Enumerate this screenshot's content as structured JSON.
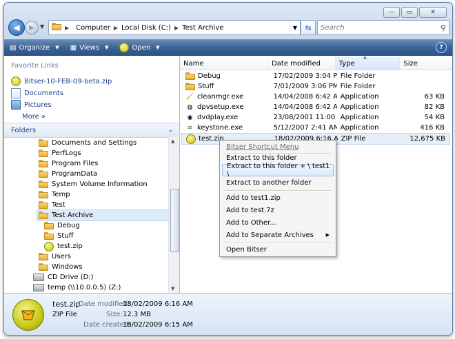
{
  "window": {
    "caption_buttons": {
      "minimize": "—",
      "maximize": "▭",
      "close": "✕"
    }
  },
  "address": {
    "segments": [
      "Computer",
      "Local Disk (C:)",
      "Test Archive"
    ],
    "search_placeholder": "Search"
  },
  "toolbar": {
    "organize": "Organize",
    "views": "Views",
    "open": "Open",
    "help": "?"
  },
  "favorites": {
    "title": "Favorite Links",
    "items": [
      "Bitser-10-FEB-09-beta.zip",
      "Documents",
      "Pictures"
    ],
    "more": "More »"
  },
  "folders": {
    "title": "Folders",
    "tree": [
      "Documents and Settings",
      "PerfLogs",
      "Program Files",
      "ProgramData",
      "System Volume Information",
      "Temp",
      "Test",
      "Test Archive",
      "Debug",
      "Stuff",
      "test.zip",
      "Users",
      "Windows",
      "CD Drive (D:)",
      "temp (\\\\10.0.0.5) (Z:)"
    ]
  },
  "columns": {
    "name": "Name",
    "date": "Date modified",
    "type": "Type",
    "size": "Size"
  },
  "files": [
    {
      "name": "Debug",
      "date": "17/02/2009 3:04 PM",
      "type": "File Folder",
      "size": ""
    },
    {
      "name": "Stuff",
      "date": "7/01/2009 3:06 PM",
      "type": "File Folder",
      "size": ""
    },
    {
      "name": "cleanmgr.exe",
      "date": "14/04/2008 6:42 AM",
      "type": "Application",
      "size": "63 KB"
    },
    {
      "name": "dpvsetup.exe",
      "date": "14/04/2008 6:42 AM",
      "type": "Application",
      "size": "82 KB"
    },
    {
      "name": "dvdplay.exe",
      "date": "23/08/2001 11:00 ...",
      "type": "Application",
      "size": "54 KB"
    },
    {
      "name": "keystone.exe",
      "date": "5/12/2007 2:41 AM",
      "type": "Application",
      "size": "416 KB"
    },
    {
      "name": "test.zip",
      "date": "18/02/2009 6:16 AM",
      "type": "ZIP File",
      "size": "12,675 KB"
    }
  ],
  "context_menu": {
    "title": "Bitser Shortcut Menu",
    "items": [
      "Extract to this folder",
      "Extract to this folder + \\ test1 \\",
      "Extract to another folder",
      "Add to test1.zip",
      "Add to test.7z",
      "Add to Other...",
      "Add to Separate Archives",
      "Open Bitser"
    ]
  },
  "details": {
    "filename": "test.zip",
    "filetype": "ZIP File",
    "modified_label": "Date modified:",
    "modified": "18/02/2009 6:16 AM",
    "size_label": "Size:",
    "size": "12.3 MB",
    "created_label": "Date created:",
    "created": "18/02/2009 6:15 AM"
  },
  "colors": {
    "toolbar": "#3d6396",
    "link": "#1c3f88",
    "menu_highlight": "#dbe9f9"
  }
}
